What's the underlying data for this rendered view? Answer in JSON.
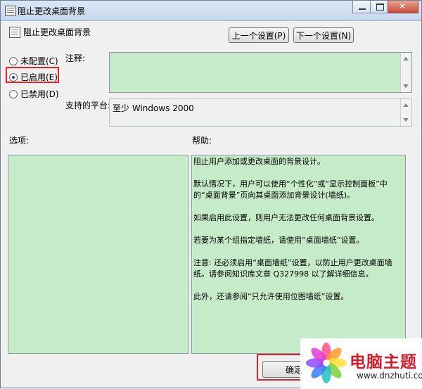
{
  "window": {
    "title": "阻止更改桌面背景"
  },
  "policy": {
    "title": "阻止更改桌面背景"
  },
  "nav": {
    "prev_label": "上一个设置(P)",
    "next_label": "下一个设置(N)"
  },
  "state": {
    "options": [
      {
        "label": "未配置(C)",
        "checked": false
      },
      {
        "label": "已启用(E)",
        "checked": true
      },
      {
        "label": "已禁用(D)",
        "checked": false
      }
    ]
  },
  "comment": {
    "label": "注释:",
    "value": ""
  },
  "platform": {
    "label": "支持的平台:",
    "value": "至少 Windows 2000"
  },
  "options_section": {
    "label": "选项:"
  },
  "help": {
    "label": "帮助:",
    "paragraphs": [
      "阻止用户添加或更改桌面的背景设计。",
      "默认情况下，用户可以使用“个性化”或“显示控制面板”中的“桌面背景”页向其桌面添加背景设计(墙纸)。",
      "如果启用此设置，则用户无法更改任何桌面背景设置。",
      "若要为某个组指定墙纸，请使用“桌面墙纸”设置。",
      "注意: 还必须启用“桌面墙纸”设置，以防止用户更改桌面墙纸。请参阅知识库文章 Q327998 以了解详细信息。",
      "此外，还请参阅“只允许使用位图墙纸”设置。"
    ]
  },
  "footer": {
    "ok_label": "确定"
  },
  "watermark": {
    "brand": "电脑主题",
    "url": "www.dnzhuti.com"
  },
  "colors": {
    "panel_green": "#c6ebc8",
    "highlight_red": "#e0242b"
  }
}
